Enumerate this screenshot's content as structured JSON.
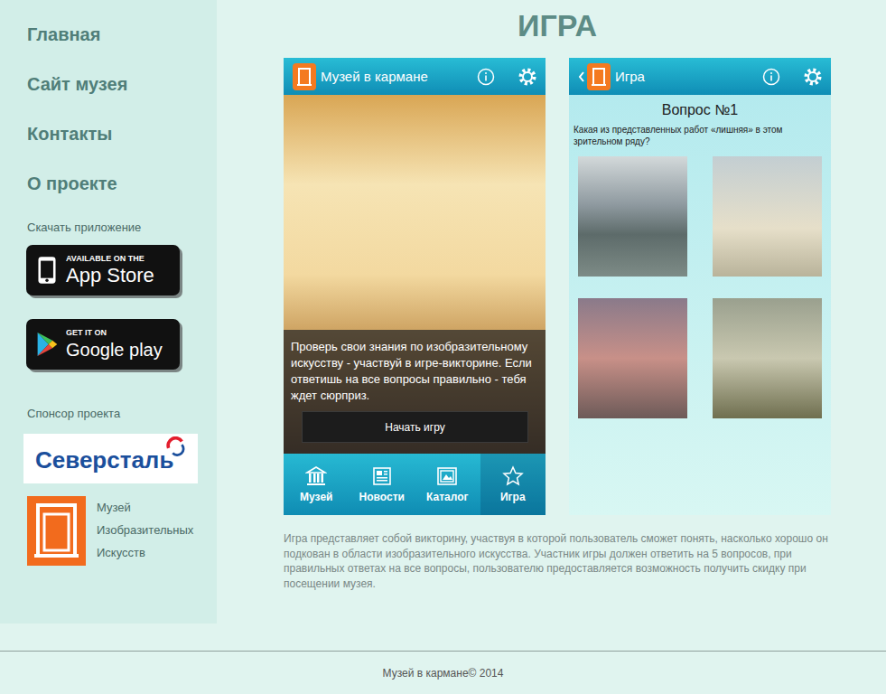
{
  "sidebar": {
    "nav": [
      "Главная",
      "Сайт музея",
      "Контакты",
      "О проекте"
    ],
    "download_title": "Скачать приложение",
    "stores": [
      {
        "kind": "appstore",
        "caption": "AVAILABLE ON THE",
        "name": "App Store"
      },
      {
        "kind": "googleplay",
        "caption": "GET IT ON",
        "name": "Google play"
      }
    ],
    "sponsor_title": "Спонсор проекта",
    "sponsor_name": "Северсталь",
    "museum_name": [
      "Музей",
      "Изобразительных",
      "Искусств"
    ]
  },
  "page_title": "ИГРА",
  "home_screen": {
    "title": "Музей в кармане",
    "intro": "Проверь свои знания по изобразительному искусству - участвуй в игре-викторине. Если ответишь на все вопросы правильно - тебя ждет сюрприз.",
    "start_button": "Начать игру",
    "tabs": [
      {
        "label": "Музей",
        "selected": false
      },
      {
        "label": "Новости",
        "selected": false
      },
      {
        "label": "Каталог",
        "selected": false
      },
      {
        "label": "Игра",
        "selected": true
      }
    ]
  },
  "game_screen": {
    "title": "Игра",
    "question_title": "Вопрос №1",
    "question": "Какая из представленных работ «лишняя» в этом зрительном ряду?"
  },
  "description": "Игра представляет собой викторину, участвуя в которой пользователь сможет понять, насколько хорошо он подкован в области изобразительного искусства. Участник игры должен ответить на 5 вопросов, при правильных ответах на все вопросы, пользователю предоставляется возможность получить скидку при посещении музея.",
  "footer": "Музей в кармане© 2014"
}
